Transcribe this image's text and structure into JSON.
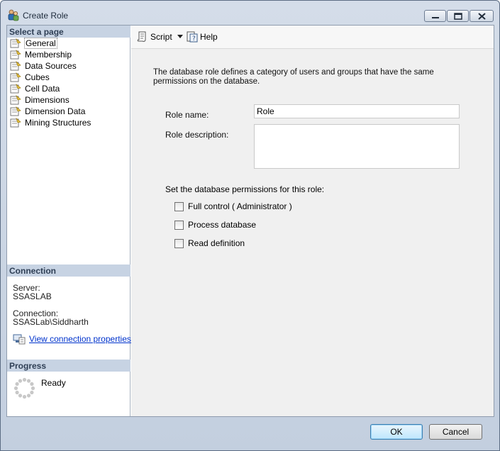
{
  "window": {
    "title": "Create Role"
  },
  "left": {
    "select_page_header": "Select a page",
    "pages": [
      {
        "label": "General",
        "icon": "page-icon"
      },
      {
        "label": "Membership",
        "icon": "page-icon"
      },
      {
        "label": "Data Sources",
        "icon": "page-icon"
      },
      {
        "label": "Cubes",
        "icon": "page-icon"
      },
      {
        "label": "Cell Data",
        "icon": "page-icon"
      },
      {
        "label": "Dimensions",
        "icon": "page-icon"
      },
      {
        "label": "Dimension Data",
        "icon": "page-icon"
      },
      {
        "label": "Mining Structures",
        "icon": "page-icon"
      }
    ],
    "selected_page": "General",
    "connection_header": "Connection",
    "server_label": "Server:",
    "server_value": "SSASLAB",
    "connection_label": "Connection:",
    "connection_value": "SSASLab\\Siddharth",
    "view_connection_link": "View connection properties",
    "progress_header": "Progress",
    "progress_status": "Ready"
  },
  "toolbar": {
    "script_label": "Script",
    "help_label": "Help"
  },
  "main": {
    "intro": "The database role defines a category of users and groups that have the same permissions on the database.",
    "role_name_label": "Role name:",
    "role_name_value": "Role",
    "role_description_label": "Role description:",
    "role_description_value": "",
    "permissions_title": "Set the database permissions for this role:",
    "permissions": [
      {
        "label": "Full control ( Administrator )",
        "checked": false
      },
      {
        "label": "Process database",
        "checked": false
      },
      {
        "label": "Read definition",
        "checked": false
      }
    ]
  },
  "footer": {
    "ok_label": "OK",
    "cancel_label": "Cancel"
  },
  "colors": {
    "section_header_bg": "#c7d3e3",
    "link": "#0033cc",
    "window_frame": "#c3cfdf"
  }
}
